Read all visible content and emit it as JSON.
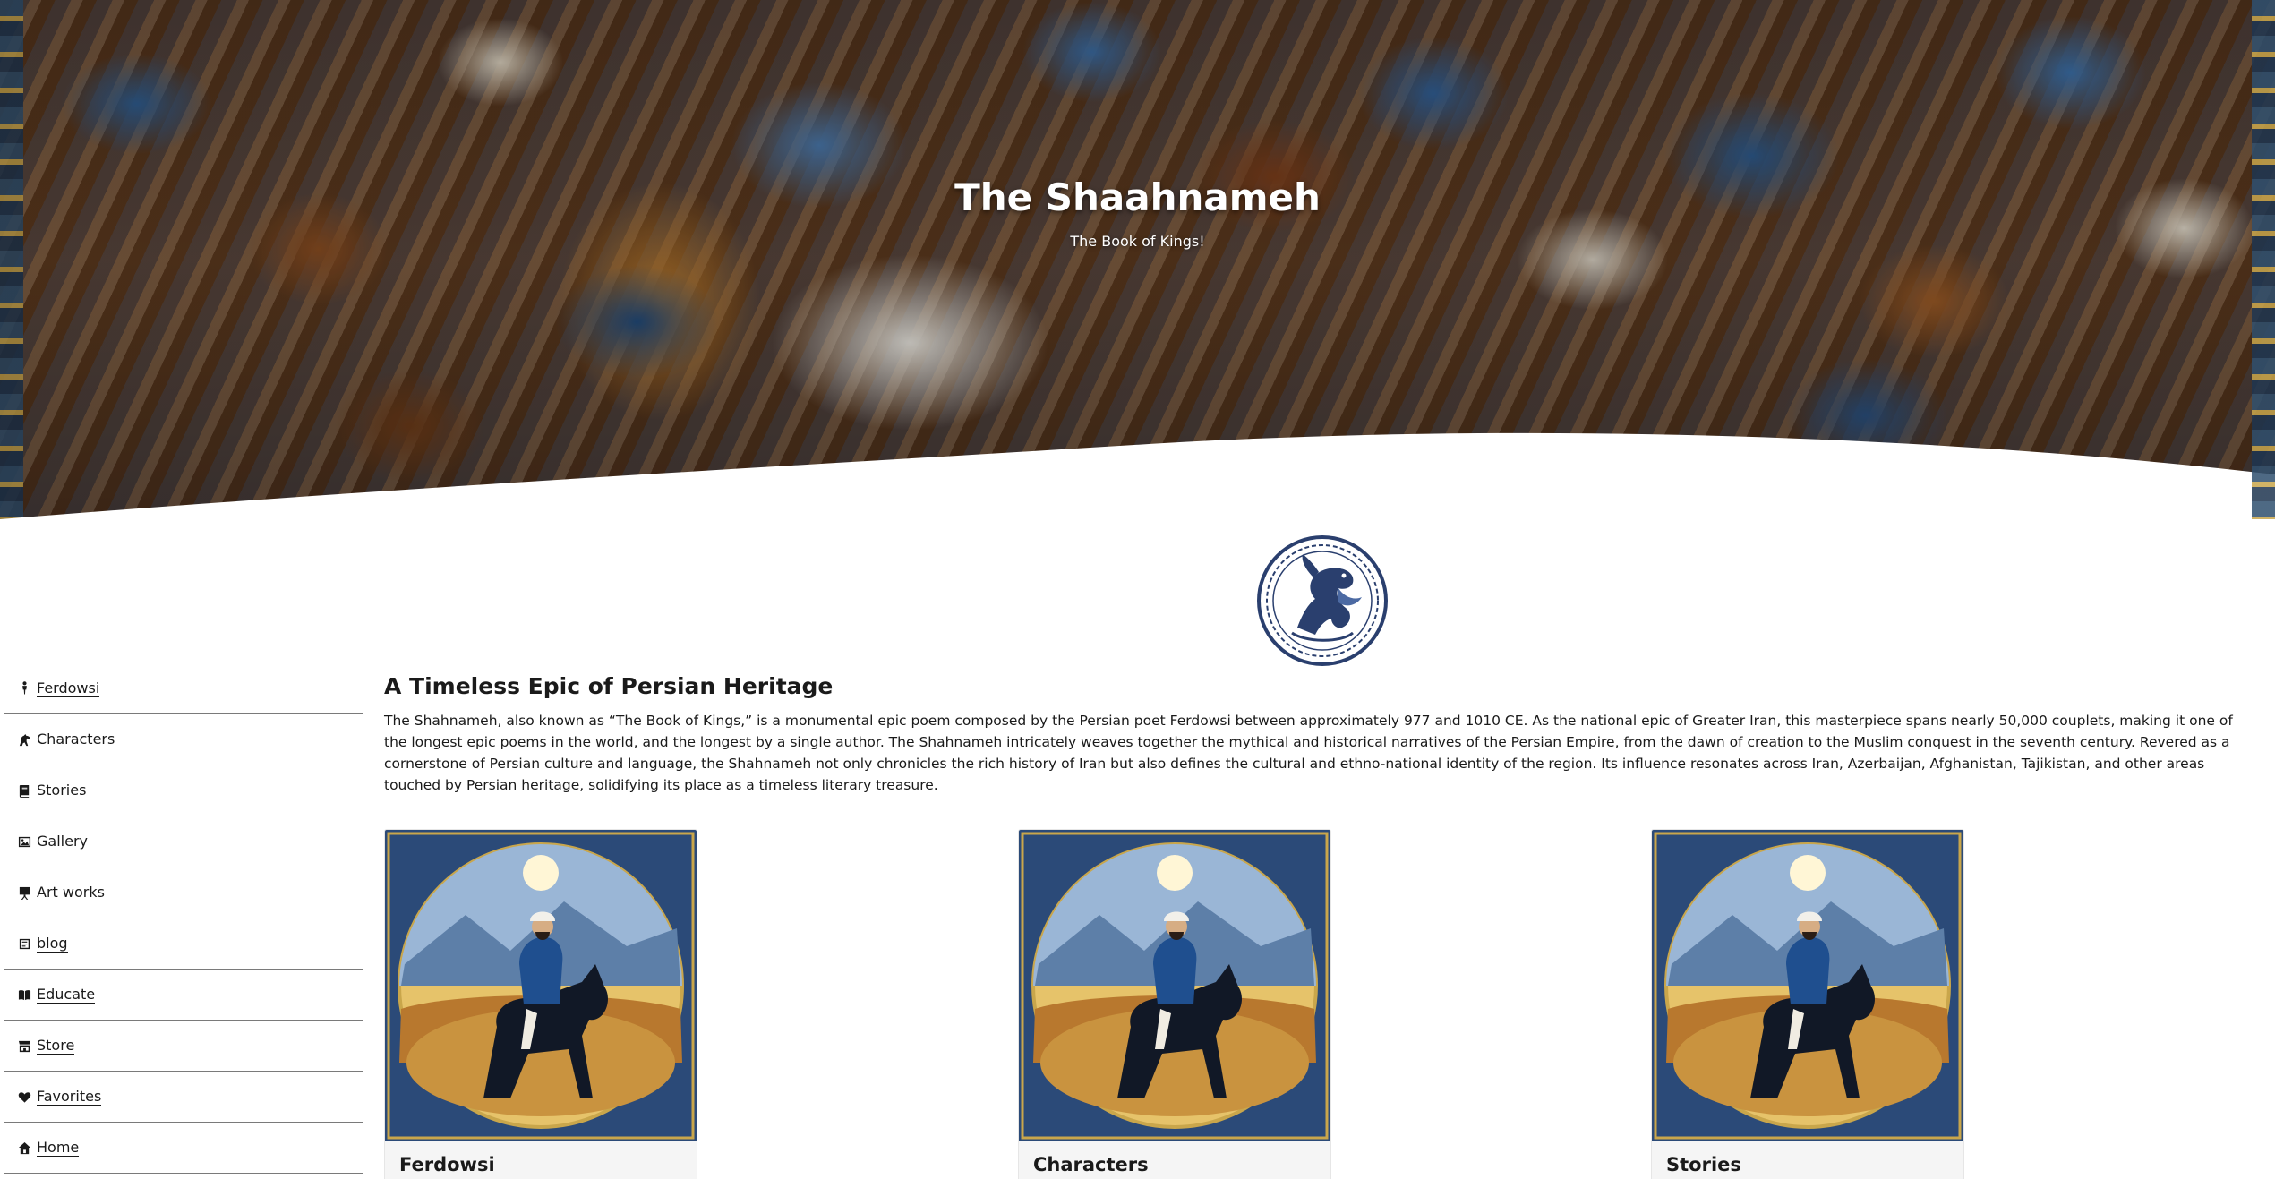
{
  "hero": {
    "title": "The Shaahnameh",
    "subtitle": "The Book of Kings!"
  },
  "sidebar": {
    "items": [
      {
        "label": "Ferdowsi",
        "icon": "person-icon"
      },
      {
        "label": "Characters",
        "icon": "horse-icon"
      },
      {
        "label": "Stories",
        "icon": "book-icon"
      },
      {
        "label": "Gallery",
        "icon": "image-icon"
      },
      {
        "label": "Art works",
        "icon": "easel-icon"
      },
      {
        "label": "blog",
        "icon": "blog-icon"
      },
      {
        "label": "Educate",
        "icon": "open-book-icon"
      },
      {
        "label": "Store",
        "icon": "store-icon"
      },
      {
        "label": "Favorites",
        "icon": "heart-icon"
      },
      {
        "label": "Home",
        "icon": "home-icon"
      }
    ]
  },
  "main": {
    "heading": "A Timeless Epic of Persian Heritage",
    "body": "The Shahnameh, also known as “The Book of Kings,” is a monumental epic poem composed by the Persian poet Ferdowsi between approximately 977 and 1010 CE. As the national epic of Greater Iran, this masterpiece spans nearly 50,000 couplets, making it one of the longest epic poems in the world, and the longest by a single author. The Shahnameh intricately weaves together the mythical and historical narratives of the Persian Empire, from the dawn of creation to the Muslim conquest in the seventh century. Revered as a cornerstone of Persian culture and language, the Shahnameh not only chronicles the rich history of Iran but also defines the cultural and ethno-national identity of the region. Its influence resonates across Iran, Azerbaijan, Afghanistan, Tajikistan, and other areas touched by Persian heritage, solidifying its place as a timeless literary treasure."
  },
  "cards": [
    {
      "title": "Ferdowsi"
    },
    {
      "title": "Characters"
    },
    {
      "title": "Stories"
    }
  ],
  "colors": {
    "text": "#1a1a1a",
    "logo_blue": "#2a3f6e",
    "card_bg": "#f5f5f5"
  }
}
